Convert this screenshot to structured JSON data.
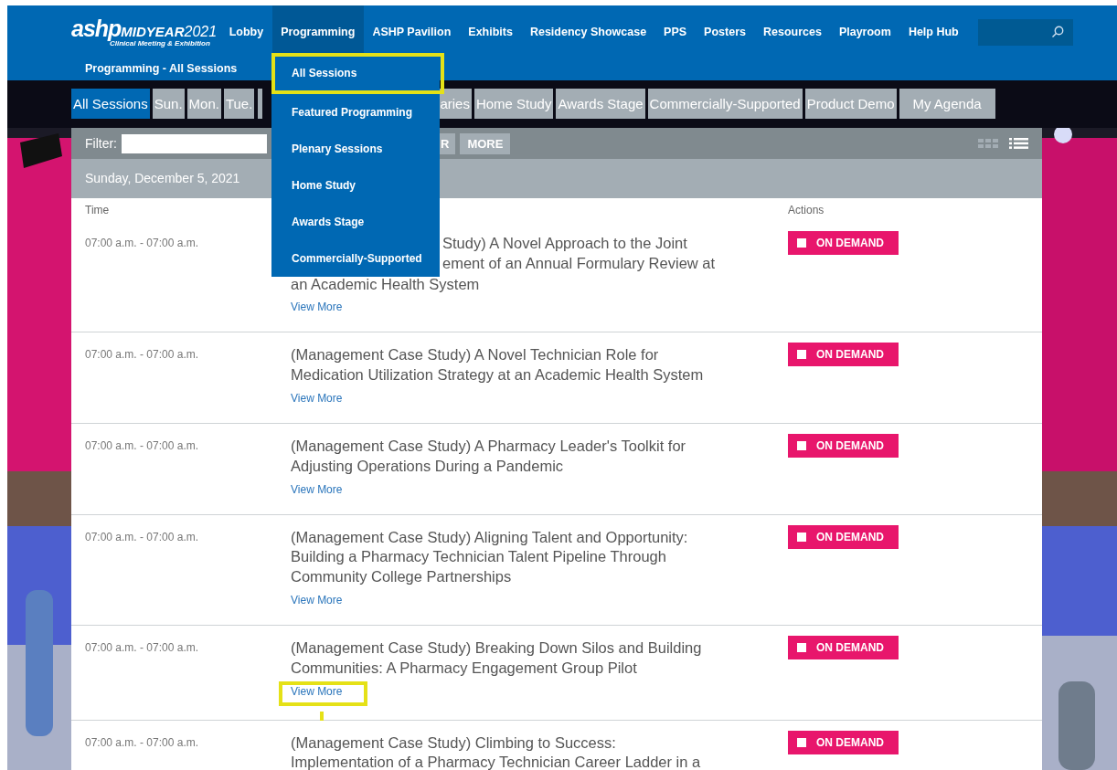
{
  "header": {
    "logo": {
      "brand": "ashp",
      "event": "MIDYEAR",
      "year": "2021",
      "tagline": "Clinical Meeting & Exhibition"
    },
    "nav": [
      {
        "label": "Lobby",
        "selected": false
      },
      {
        "label": "Programming",
        "selected": true
      },
      {
        "label": "ASHP Pavilion",
        "selected": false
      },
      {
        "label": "Exhibits",
        "selected": false
      },
      {
        "label": "Residency Showcase",
        "selected": false
      },
      {
        "label": "PPS",
        "selected": false
      },
      {
        "label": "Posters",
        "selected": false
      },
      {
        "label": "Resources",
        "selected": false
      },
      {
        "label": "Playroom",
        "selected": false
      },
      {
        "label": "Help Hub",
        "selected": false
      }
    ],
    "breadcrumb": "Programming - All Sessions"
  },
  "menu": {
    "items": [
      {
        "label": "All Sessions",
        "highlighted": true
      },
      {
        "label": "Featured Programming",
        "highlighted": false
      },
      {
        "label": "Plenary Sessions",
        "highlighted": false
      },
      {
        "label": "Home Study",
        "highlighted": false
      },
      {
        "label": "Awards Stage",
        "highlighted": false
      },
      {
        "label": "Commercially-Supported",
        "highlighted": false
      }
    ]
  },
  "tabs": [
    {
      "label": "All Sessions",
      "selected": true
    },
    {
      "label": "Sun.",
      "selected": false
    },
    {
      "label": "Mon.",
      "selected": false
    },
    {
      "label": "Tue.",
      "selected": false
    },
    {
      "label": "aries",
      "selected": false,
      "partly_hidden": true
    },
    {
      "label": "Home Study",
      "selected": false
    },
    {
      "label": "Awards Stage",
      "selected": false
    },
    {
      "label": "Commercially-Supported",
      "selected": false
    },
    {
      "label": "Product Demo",
      "selected": false
    },
    {
      "label": "My Agenda",
      "selected": false
    }
  ],
  "filter": {
    "label": "Filter:",
    "buttons": [
      "R",
      "MORE"
    ]
  },
  "day": "Sunday, December 5, 2021",
  "columns": {
    "time": "Time",
    "actions": "Actions"
  },
  "rows": [
    {
      "time": "07:00 a.m. - 07:00 a.m.",
      "title": [
        {
          "lines": [
            "Study) A Novel Approach to the Joint",
            "ement of an Annual Formulary Review at"
          ],
          "partly_hidden": true
        },
        {
          "lines": [
            "an Academic Health System"
          ]
        }
      ],
      "link": "View More",
      "highlighted": false,
      "action": "ON DEMAND"
    },
    {
      "time": "07:00 a.m. - 07:00 a.m.",
      "title": [
        {
          "lines": [
            "(Management Case Study) A Novel Technician Role for",
            "Medication Utilization Strategy at an Academic Health System"
          ],
          "partly_hidden": false
        }
      ],
      "link": "View More",
      "highlighted": false,
      "action": "ON DEMAND"
    },
    {
      "time": "07:00 a.m. - 07:00 a.m.",
      "title": [
        {
          "lines": [
            "(Management Case Study) A Pharmacy Leader's Toolkit for",
            "Adjusting Operations During a Pandemic"
          ],
          "partly_hidden": false
        }
      ],
      "link": "View More",
      "highlighted": false,
      "action": "ON DEMAND"
    },
    {
      "time": "07:00 a.m. - 07:00 a.m.",
      "title": [
        {
          "lines": [
            "(Management Case Study) Aligning Talent and Opportunity:",
            "Building a Pharmacy Technician Talent Pipeline Through",
            "Community College Partnerships"
          ],
          "partly_hidden": false
        }
      ],
      "link": "View More",
      "highlighted": false,
      "action": "ON DEMAND"
    },
    {
      "time": "07:00 a.m. - 07:00 a.m.",
      "title": [
        {
          "lines": [
            "(Management Case Study) Breaking Down Silos and Building",
            "Communities: A Pharmacy Engagement Group Pilot"
          ],
          "partly_hidden": false
        }
      ],
      "link": "View More",
      "highlighted": true,
      "action": "ON DEMAND"
    },
    {
      "time": "07:00 a.m. - 07:00 a.m.",
      "title": [
        {
          "lines": [
            "(Management Case Study) Climbing to Success:",
            "Implementation of a Pharmacy Technician Career Ladder in a"
          ],
          "partly_hidden": false
        }
      ],
      "action": "ON DEMAND"
    }
  ]
}
